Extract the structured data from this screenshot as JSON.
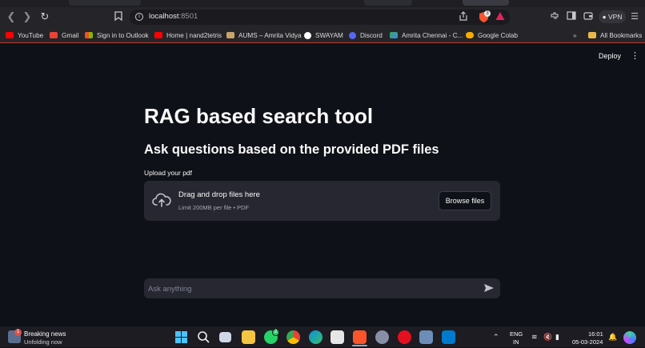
{
  "browser": {
    "address_host": "localhost",
    "address_port": ":8501",
    "vpn_label": "VPN",
    "shields_count": "3",
    "bookmarks": [
      {
        "label": "YouTube",
        "color": "#ff0000"
      },
      {
        "label": "Gmail",
        "color": "#ea4335"
      },
      {
        "label": "Sign in to Outlook",
        "color": "#f25022"
      },
      {
        "label": "Home | nand2tetris",
        "color": "#ff0000"
      },
      {
        "label": "AUMS – Amrita Vidya",
        "color": "#c9a46a"
      },
      {
        "label": "SWAYAM",
        "color": "#ffffff"
      },
      {
        "label": "Discord",
        "color": "#5865f2"
      },
      {
        "label": "Amrita Chennai - C...",
        "color": "#34a853"
      },
      {
        "label": "Google Colab",
        "color": "#f9ab00"
      }
    ],
    "more_label": "»",
    "all_bookmarks": "All Bookmarks"
  },
  "app": {
    "deploy_label": "Deploy",
    "title": "RAG based search tool",
    "subtitle": "Ask questions based on the provided PDF files",
    "upload_label": "Upload your pdf",
    "dropzone_title": "Drag and drop files here",
    "dropzone_limit": "Limit 200MB per file • PDF",
    "browse_label": "Browse files",
    "chat_placeholder": "Ask anything"
  },
  "taskbar": {
    "news_title": "Breaking news",
    "news_subtitle": "Unfolding now",
    "news_badge": "1",
    "whatsapp_badge": "2",
    "lang_line1": "ENG",
    "lang_line2": "IN",
    "time": "16:01",
    "date": "05-03-2024"
  },
  "icons": [
    "back-icon",
    "forward-icon",
    "reload-icon",
    "bookmark-icon",
    "info-icon",
    "share-icon",
    "brave-shields-icon",
    "brave-rewards-icon",
    "extensions-icon",
    "sidebar-icon",
    "wallet-icon",
    "menu-icon",
    "cloud-upload-icon",
    "send-icon",
    "windows-start-icon",
    "search-icon"
  ]
}
